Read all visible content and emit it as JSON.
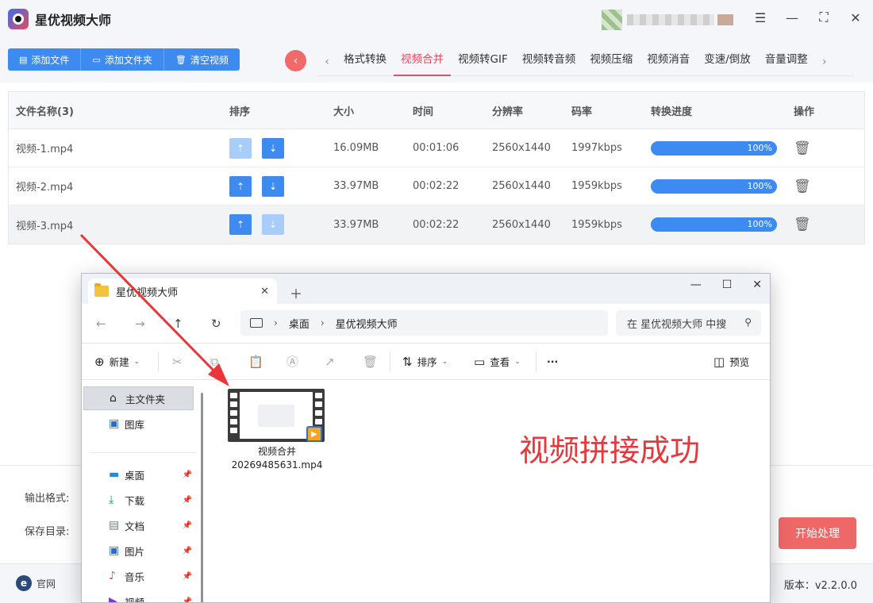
{
  "app": {
    "title": "星优视频大师"
  },
  "toolbar": {
    "add_file": "添加文件",
    "add_folder": "添加文件夹",
    "clear": "清空视频"
  },
  "tabs": [
    {
      "label": "格式转换"
    },
    {
      "label": "视频合并",
      "active": true
    },
    {
      "label": "视频转GIF"
    },
    {
      "label": "视频转音频"
    },
    {
      "label": "视频压缩"
    },
    {
      "label": "视频消音"
    },
    {
      "label": "变速/倒放"
    },
    {
      "label": "音量调整"
    }
  ],
  "table": {
    "headers": {
      "name": "文件名称(3)",
      "order": "排序",
      "size": "大小",
      "time": "时间",
      "resolution": "分辨率",
      "bitrate": "码率",
      "progress": "转换进度",
      "action": "操作"
    },
    "rows": [
      {
        "name": "视频-1.mp4",
        "size": "16.09MB",
        "time": "00:01:06",
        "resolution": "2560x1440",
        "bitrate": "1997kbps",
        "progress": "100%"
      },
      {
        "name": "视频-2.mp4",
        "size": "33.97MB",
        "time": "00:02:22",
        "resolution": "2560x1440",
        "bitrate": "1959kbps",
        "progress": "100%"
      },
      {
        "name": "视频-3.mp4",
        "size": "33.97MB",
        "time": "00:02:22",
        "resolution": "2560x1440",
        "bitrate": "1959kbps",
        "progress": "100%"
      }
    ]
  },
  "bottom": {
    "output_format": "输出格式:",
    "save_dir": "保存目录:",
    "start": "开始处理"
  },
  "footer": {
    "site": "官网",
    "version": "版本：v2.2.0.0"
  },
  "explorer": {
    "tab_title": "星优视频大师",
    "breadcrumb": [
      "桌面",
      "星优视频大师"
    ],
    "search_placeholder": "在 星优视频大师 中搜",
    "commands": {
      "new": "新建",
      "sort": "排序",
      "view": "查看",
      "more": "···",
      "preview": "预览"
    },
    "sidebar": [
      {
        "label": "主文件夹",
        "selected": true
      },
      {
        "label": "图库"
      },
      {
        "label": "桌面"
      },
      {
        "label": "下载"
      },
      {
        "label": "文档"
      },
      {
        "label": "图片"
      },
      {
        "label": "音乐"
      },
      {
        "label": "视频"
      }
    ],
    "file": {
      "name_line1": "视频合并",
      "name_line2": "20269485631.mp4"
    }
  },
  "annotation": {
    "text": "视频拼接成功",
    "color": "#e8363a"
  },
  "colors": {
    "accent_blue": "#3d8bf0",
    "accent_red": "#ef6868",
    "tab_active": "#e84a5f"
  }
}
